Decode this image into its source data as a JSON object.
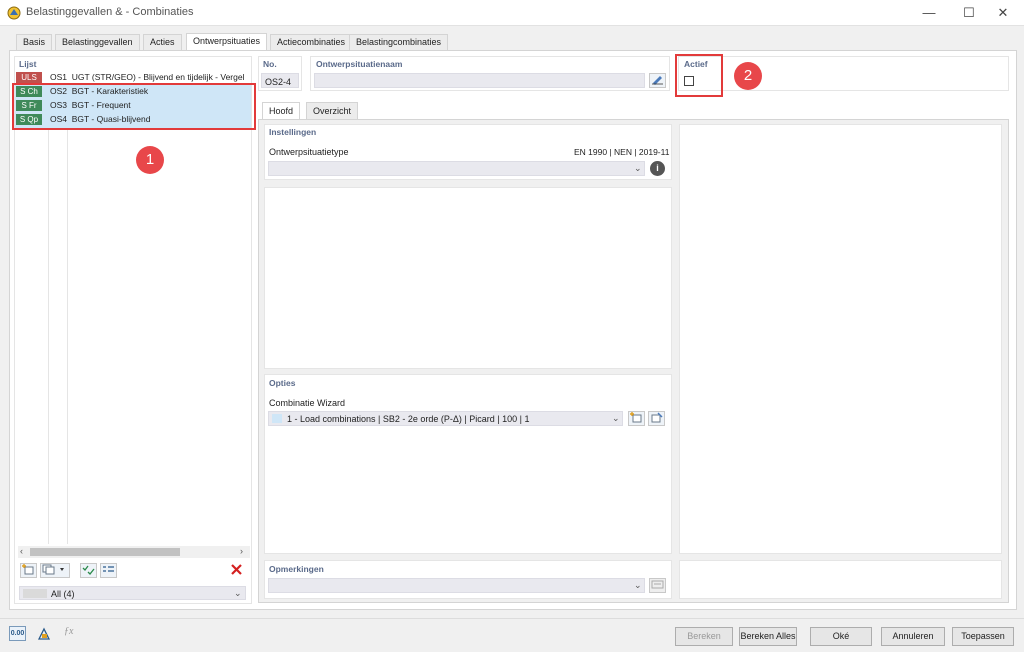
{
  "window": {
    "title": "Belastinggevallen & - Combinaties",
    "minimize": "—",
    "maximize": "☐",
    "close": "✕"
  },
  "tabs": [
    "Basis",
    "Belastinggevallen",
    "Acties",
    "Ontwerpsituaties",
    "Actiecombinaties",
    "Belastingcombinaties"
  ],
  "list": {
    "label": "Lijst",
    "items": [
      {
        "badge": "ULS",
        "badge_color": "#c0504d",
        "id": "OS1",
        "text": "UGT (STR/GEO) - Blijvend en tijdelijk - Vergel"
      },
      {
        "badge": "S Ch",
        "badge_color": "#3f8a5a",
        "id": "OS2",
        "text": "BGT - Karakteristiek"
      },
      {
        "badge": "S Fr",
        "badge_color": "#3f8a5a",
        "id": "OS3",
        "text": "BGT - Frequent"
      },
      {
        "badge": "S Qp",
        "badge_color": "#3f8a5a",
        "id": "OS4",
        "text": "BGT - Quasi-blijvend"
      }
    ],
    "filter_value": "All (4)"
  },
  "header": {
    "no_label": "No.",
    "no_value": "OS2-4",
    "name_label": "Ontwerpsituatienaam",
    "name_value": "",
    "active_label": "Actief"
  },
  "inner_tabs": [
    "Hoofd",
    "Overzicht"
  ],
  "settings": {
    "label": "Instellingen",
    "type_label": "Ontwerpsituatietype",
    "standard": "EN 1990 | NEN | 2019-11",
    "type_value": ""
  },
  "options": {
    "label": "Opties",
    "wizard_label": "Combinatie Wizard",
    "wizard_value": "1 - Load combinations | SB2 - 2e orde (P-Δ) | Picard | 100 | 1"
  },
  "remarks": {
    "label": "Opmerkingen",
    "value": ""
  },
  "callouts": [
    "1",
    "2"
  ],
  "footer": {
    "bereken": "Bereken",
    "bereken_alles": "Bereken Alles",
    "oke": "Oké",
    "annuleren": "Annuleren",
    "toepassen": "Toepassen",
    "units_icon_label": "0.00"
  },
  "colors": {
    "highlight_red": "#e23a3a",
    "selection_blue": "#cfe6f7",
    "accent_blue": "#5a6a8a"
  }
}
